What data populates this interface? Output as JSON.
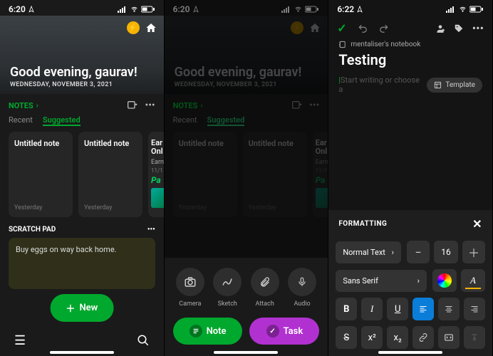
{
  "status": {
    "time1": "6:20",
    "time2": "6:20",
    "time3": "6:22"
  },
  "hero": {
    "greeting": "Good evening, gaurav!",
    "date": "WEDNESDAY, NOVEMBER 3, 2021"
  },
  "notes": {
    "header": "NOTES",
    "tabs": {
      "recent": "Recent",
      "suggested": "Suggested"
    },
    "cards": [
      {
        "title": "Untitled note",
        "date": "Yesterday"
      },
      {
        "title": "Untitled note",
        "date": "Yesterday"
      }
    ],
    "promo": {
      "t1": "Ear",
      "t2": "Onl",
      "sub": "Earn",
      "date": "11/1",
      "brand": "Pa"
    }
  },
  "scratch": {
    "header": "SCRATCH PAD",
    "text": "Buy eggs on way back home."
  },
  "new_btn": "New",
  "attach": {
    "camera": "Camera",
    "sketch": "Sketch",
    "attach": "Attach",
    "audio": "Audio"
  },
  "create": {
    "note": "Note",
    "task": "Task"
  },
  "editor": {
    "notebook": "mentaliser's notebook",
    "title": "Testing",
    "placeholder": "Start writing or choose a",
    "template": "Template"
  },
  "fmt": {
    "header": "FORMATTING",
    "style": "Normal Text",
    "font": "Sans Serif",
    "size": "16"
  }
}
